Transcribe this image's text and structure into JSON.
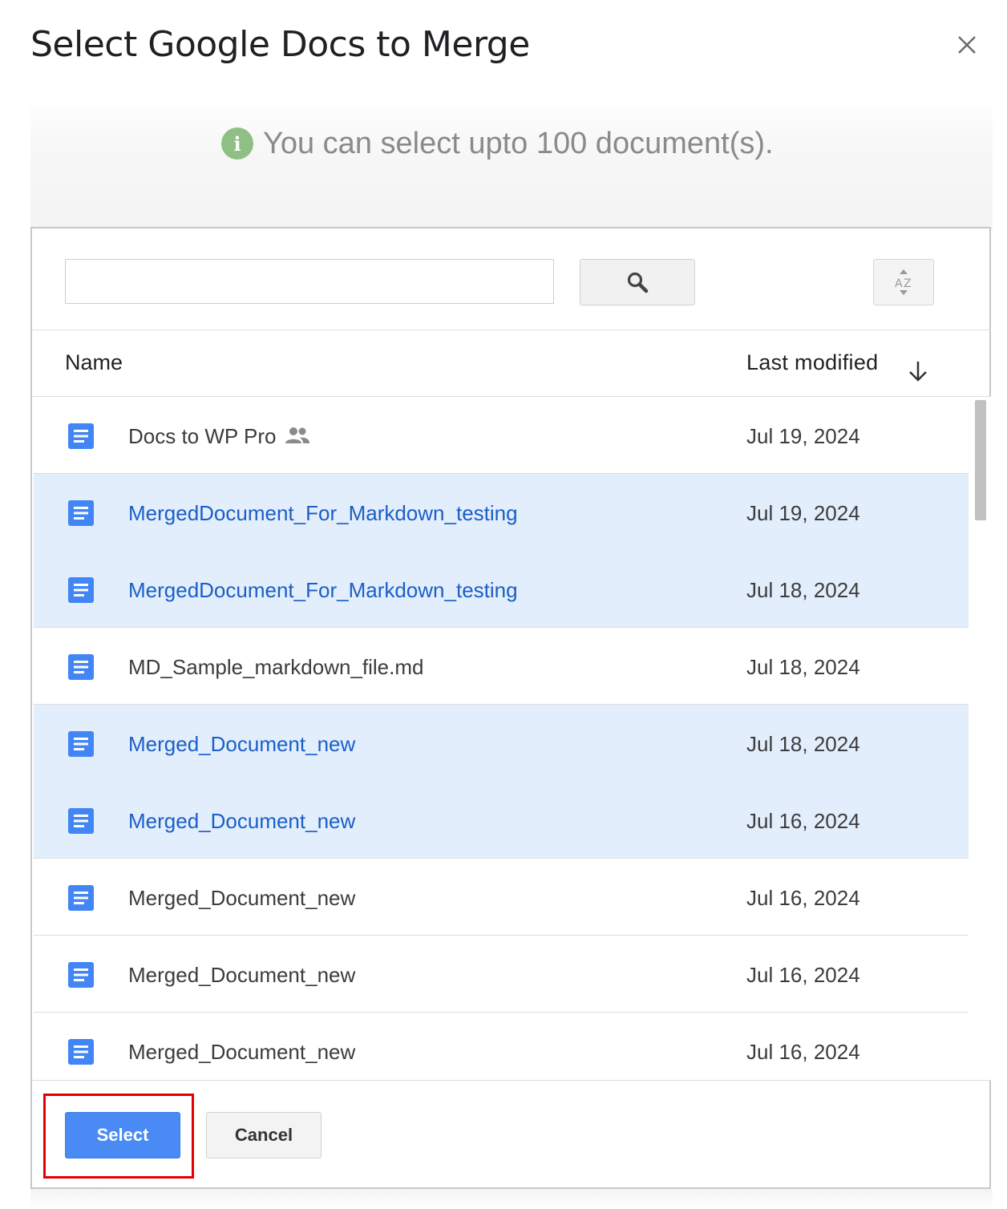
{
  "dialog": {
    "title": "Select Google Docs to Merge",
    "info_text": "You can select upto 100 document(s).",
    "info_icon": "info-icon"
  },
  "search": {
    "value": "",
    "placeholder": "",
    "button_icon": "search-icon",
    "sort_icon": "sort-az-icon"
  },
  "columns": {
    "name": "Name",
    "last_modified": "Last modified"
  },
  "files": [
    {
      "name": "Docs to WP Pro",
      "date": "Jul 19, 2024",
      "selected": false,
      "shared": true
    },
    {
      "name": "MergedDocument_For_Markdown_testing",
      "date": "Jul 19, 2024",
      "selected": true,
      "shared": false
    },
    {
      "name": "MergedDocument_For_Markdown_testing",
      "date": "Jul 18, 2024",
      "selected": true,
      "shared": false
    },
    {
      "name": "MD_Sample_markdown_file.md",
      "date": "Jul 18, 2024",
      "selected": false,
      "shared": false
    },
    {
      "name": "Merged_Document_new",
      "date": "Jul 18, 2024",
      "selected": true,
      "shared": false
    },
    {
      "name": "Merged_Document_new",
      "date": "Jul 16, 2024",
      "selected": true,
      "shared": false
    },
    {
      "name": "Merged_Document_new",
      "date": "Jul 16, 2024",
      "selected": false,
      "shared": false
    },
    {
      "name": "Merged_Document_new",
      "date": "Jul 16, 2024",
      "selected": false,
      "shared": false
    },
    {
      "name": "Merged_Document_new",
      "date": "Jul 16, 2024",
      "selected": false,
      "shared": false
    }
  ],
  "footer": {
    "select_label": "Select",
    "cancel_label": "Cancel"
  },
  "colors": {
    "selected_row": "#e3eefc",
    "selected_text": "#1a5fc7",
    "primary_button": "#4a8af4",
    "highlight": "#e10000",
    "doc_icon": "#4285f4"
  }
}
